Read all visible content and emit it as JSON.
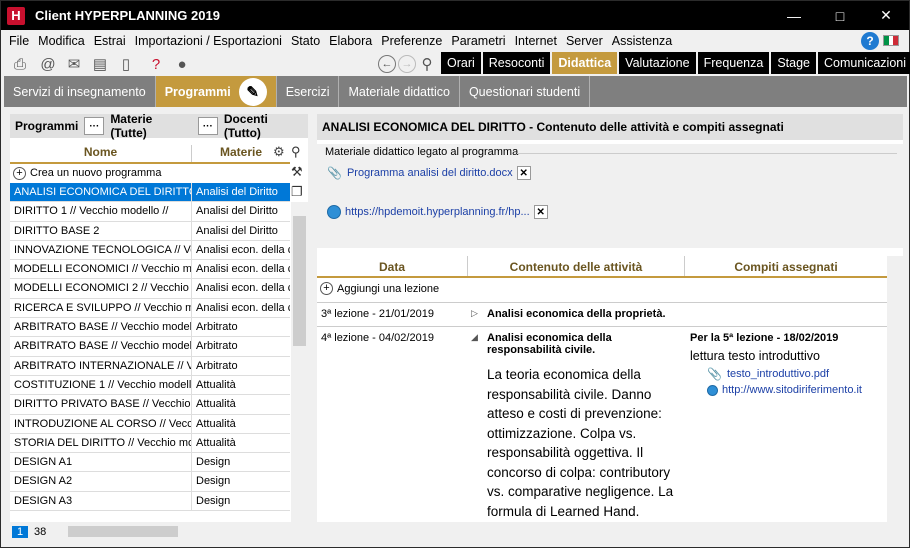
{
  "window": {
    "title": "Client HYPERPLANNING 2019",
    "app_letter": "H"
  },
  "menu": [
    "File",
    "Modifica",
    "Estrai",
    "Importazioni / Esportazioni",
    "Stato",
    "Elabora",
    "Preferenze",
    "Parametri",
    "Internet",
    "Server",
    "Assistenza"
  ],
  "help_label": "?",
  "top_tabs": [
    "Orari",
    "Resoconti",
    "Didattica",
    "Valutazione",
    "Frequenza",
    "Stage",
    "Comunicazioni"
  ],
  "active_top_tab": "Didattica",
  "sub_tabs": [
    "Servizi di insegnamento",
    "Programmi",
    "Esercizi",
    "Materiale didattico",
    "Questionari studenti"
  ],
  "filters": {
    "programmi": "Programmi",
    "materie": "Materie (Tutte)",
    "docenti": "Docenti (Tutto)",
    "dots": "···"
  },
  "list": {
    "col_nome": "Nome",
    "col_materie": "Materie",
    "create_label": "Crea un nuovo programma",
    "rows": [
      [
        "ANALISI ECONOMICA DEL DIRITTO",
        "Analisi del Diritto"
      ],
      [
        "DIRITTO 1 // Vecchio modello //",
        "Analisi del Diritto"
      ],
      [
        "DIRITTO BASE 2",
        "Analisi del Diritto"
      ],
      [
        "INNOVAZIONE TECNOLOGICA // Vec",
        "Analisi econ. della c"
      ],
      [
        "MODELLI ECONOMICI // Vecchio mo",
        "Analisi econ. della c"
      ],
      [
        "MODELLI ECONOMICI 2 // Vecchio m",
        "Analisi econ. della c"
      ],
      [
        "RICERCA E SVILUPPO // Vecchio mo",
        "Analisi econ. della c"
      ],
      [
        "ARBITRATO BASE // Vecchio modell",
        "Arbitrato"
      ],
      [
        "ARBITRATO BASE // Vecchio modell",
        "Arbitrato"
      ],
      [
        "ARBITRATO INTERNAZIONALE // Vec",
        "Arbitrato"
      ],
      [
        "COSTITUZIONE 1 // Vecchio modello",
        "Attualità"
      ],
      [
        "DIRITTO PRIVATO BASE // Vecchio r",
        "Attualità"
      ],
      [
        "INTRODUZIONE AL CORSO // Vecch",
        "Attualità"
      ],
      [
        "STORIA DEL DIRITTO // Vecchio mod",
        "Attualità"
      ],
      [
        "DESIGN A1",
        "Design"
      ],
      [
        "DESIGN A2",
        "Design"
      ],
      [
        "DESIGN A3",
        "Design"
      ]
    ],
    "page_current": "1",
    "page_total": "38"
  },
  "right": {
    "title": "ANALISI ECONOMICA DEL DIRITTO - Contenuto delle attività e compiti assegnati",
    "material_label": "Materiale didattico legato al programma",
    "material_file": "Programma analisi del diritto.docx",
    "material_url": "https://hpdemoit.hyperplanning.fr/hp...",
    "col_data": "Data",
    "col_contenuto": "Contenuto delle attività",
    "col_compiti": "Compiti assegnati",
    "add_lesson": "Aggiungi una lezione",
    "lesson3": {
      "date": "3ª lezione - 21/01/2019",
      "title": "Analisi economica della proprietà."
    },
    "lesson4": {
      "date": "4ª lezione - 04/02/2019",
      "title": "Analisi economica della responsabilità civile.",
      "body": "La teoria economica della responsabilità civile. Danno atteso e costi di prevenzione: ottimizzazione. Colpa vs. responsabilità oggettiva. Il concorso di colpa: contributory vs. comparative negligence. La formula di Learned Hand. Responsabilità civile",
      "hw_title": "Per la 5ª lezione - 18/02/2019",
      "hw_text": "lettura testo introduttivo",
      "hw_file": "testo_introduttivo.pdf",
      "hw_url": "http://www.sitodiriferimento.it"
    }
  },
  "colors": {
    "accent": "#c49a3e",
    "selection": "#0078d7",
    "tabbar": "#7f7f7f"
  }
}
